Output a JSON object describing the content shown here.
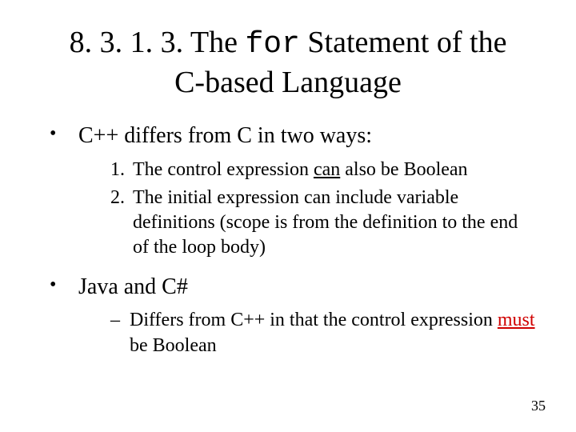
{
  "title": {
    "prefix": "8. 3. 1. 3. The ",
    "code": "for",
    "suffix": " Statement of the C-based Language"
  },
  "bullets": [
    {
      "text": "C++ differs from C in two ways:",
      "numbered": [
        {
          "pre": "The control expression ",
          "u": "can",
          "post": " also be Boolean"
        },
        {
          "pre": "The initial expression can include variable definitions (scope is from the definition to the end of the loop body)",
          "u": "",
          "post": ""
        }
      ]
    },
    {
      "text": "Java and C#",
      "dashed": [
        {
          "pre": "Differs from C++ in that the control expression ",
          "red": "must",
          "post": " be Boolean"
        }
      ]
    }
  ],
  "pageNumber": "35"
}
